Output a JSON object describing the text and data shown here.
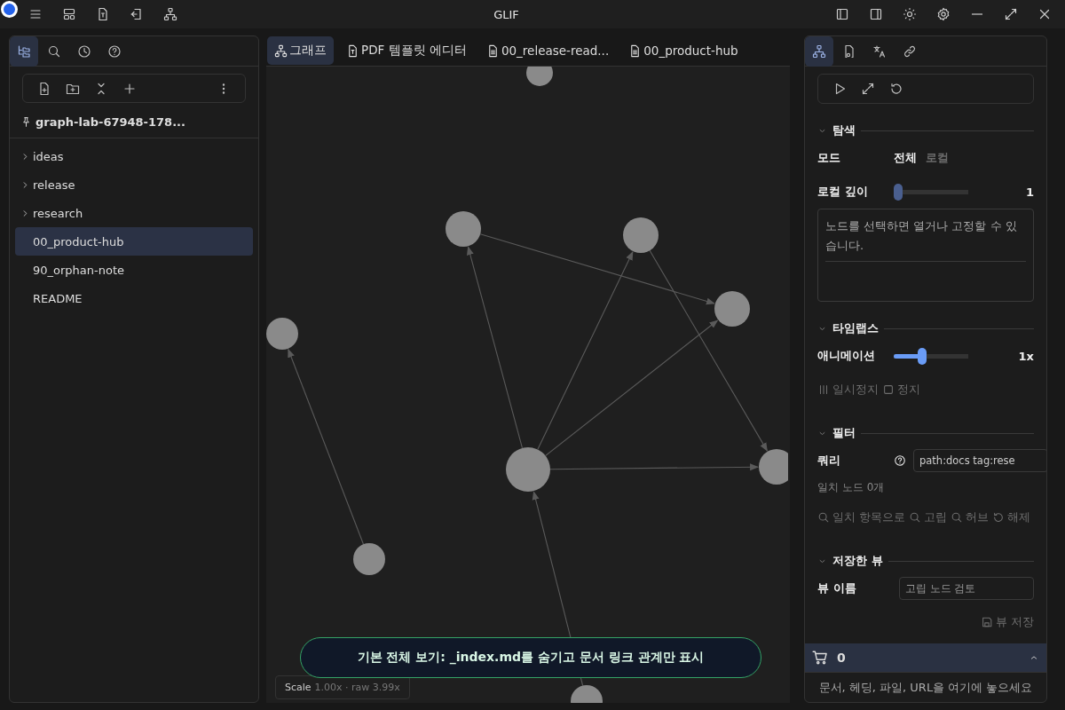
{
  "window": {
    "title": "GLIF"
  },
  "left_panel": {
    "tabs": [
      {
        "selected": true
      },
      {
        "selected": false
      },
      {
        "selected": false
      },
      {
        "selected": false
      }
    ],
    "vault": "graph-lab-67948-178...",
    "tree": [
      {
        "label": "ideas",
        "expanded": false,
        "folder": true,
        "selected": false
      },
      {
        "label": "release",
        "expanded": false,
        "folder": true,
        "selected": false
      },
      {
        "label": "research",
        "expanded": false,
        "folder": true,
        "selected": false
      },
      {
        "label": "00_product-hub",
        "folder": false,
        "selected": true
      },
      {
        "label": "90_orphan-note",
        "folder": false,
        "selected": false
      },
      {
        "label": "README",
        "folder": false,
        "selected": false
      }
    ]
  },
  "editor_tabs": [
    {
      "label": "그래프",
      "kind": "graph",
      "selected": true
    },
    {
      "label": "PDF 템플릿 에디터",
      "kind": "template",
      "selected": false
    },
    {
      "label": "00_release-read...",
      "kind": "doc",
      "selected": false
    },
    {
      "label": "00_product-hub",
      "kind": "doc",
      "selected": false
    }
  ],
  "graph": {
    "scale_label": "Scale",
    "scale_value": "1.00x · raw 3.99x",
    "toast": "기본 전체 보기: _index.md를 숨기고 문서 링크 관계만 표시"
  },
  "right_panel": {
    "tabs": [
      {
        "selected": true
      },
      {
        "selected": false
      },
      {
        "selected": false
      },
      {
        "selected": false
      }
    ],
    "explore": {
      "title": "탐색",
      "expanded": true,
      "mode_label": "모드",
      "modes": [
        {
          "label": "전체",
          "selected": true
        },
        {
          "label": "로컬",
          "selected": false
        }
      ],
      "depth_label": "로컬 깊이",
      "depth": {
        "level": 0.0
      },
      "depth_value": "1",
      "hint": "노드를 선택하면 열거나 고정할 수 있습니다."
    },
    "timelapse": {
      "title": "타임랩스",
      "expanded": true,
      "anim_label": "애니메이션",
      "anim": {
        "level": 0.36
      },
      "anim_value": "1x",
      "buttons": [
        {
          "label": "일시정지",
          "kind": "pause",
          "disabled": true
        },
        {
          "label": "정지",
          "kind": "stop",
          "disabled": true
        }
      ]
    },
    "filter": {
      "title": "필터",
      "expanded": true,
      "query_label": "쿼리",
      "query_value": "path:docs tag:rese",
      "match_count": "일치 노드 0개",
      "buttons": [
        {
          "label": "일치 항목으로",
          "kind": "search",
          "disabled": true
        },
        {
          "label": "고립",
          "kind": "search",
          "disabled": true
        },
        {
          "label": "허브",
          "kind": "search",
          "disabled": true
        },
        {
          "label": "해제",
          "kind": "reset",
          "disabled": true
        }
      ]
    },
    "saved_views": {
      "title": "저장한 뷰",
      "expanded": true,
      "name_label": "뷰 이름",
      "name_placeholder": "고립 노드 검토",
      "save_button": {
        "label": "뷰 저장",
        "disabled": true
      }
    },
    "cart": {
      "count": "0",
      "expanded": false,
      "drop_hint": "문서, 헤딩, 파일, URL을 여기에 놓으세요"
    }
  }
}
